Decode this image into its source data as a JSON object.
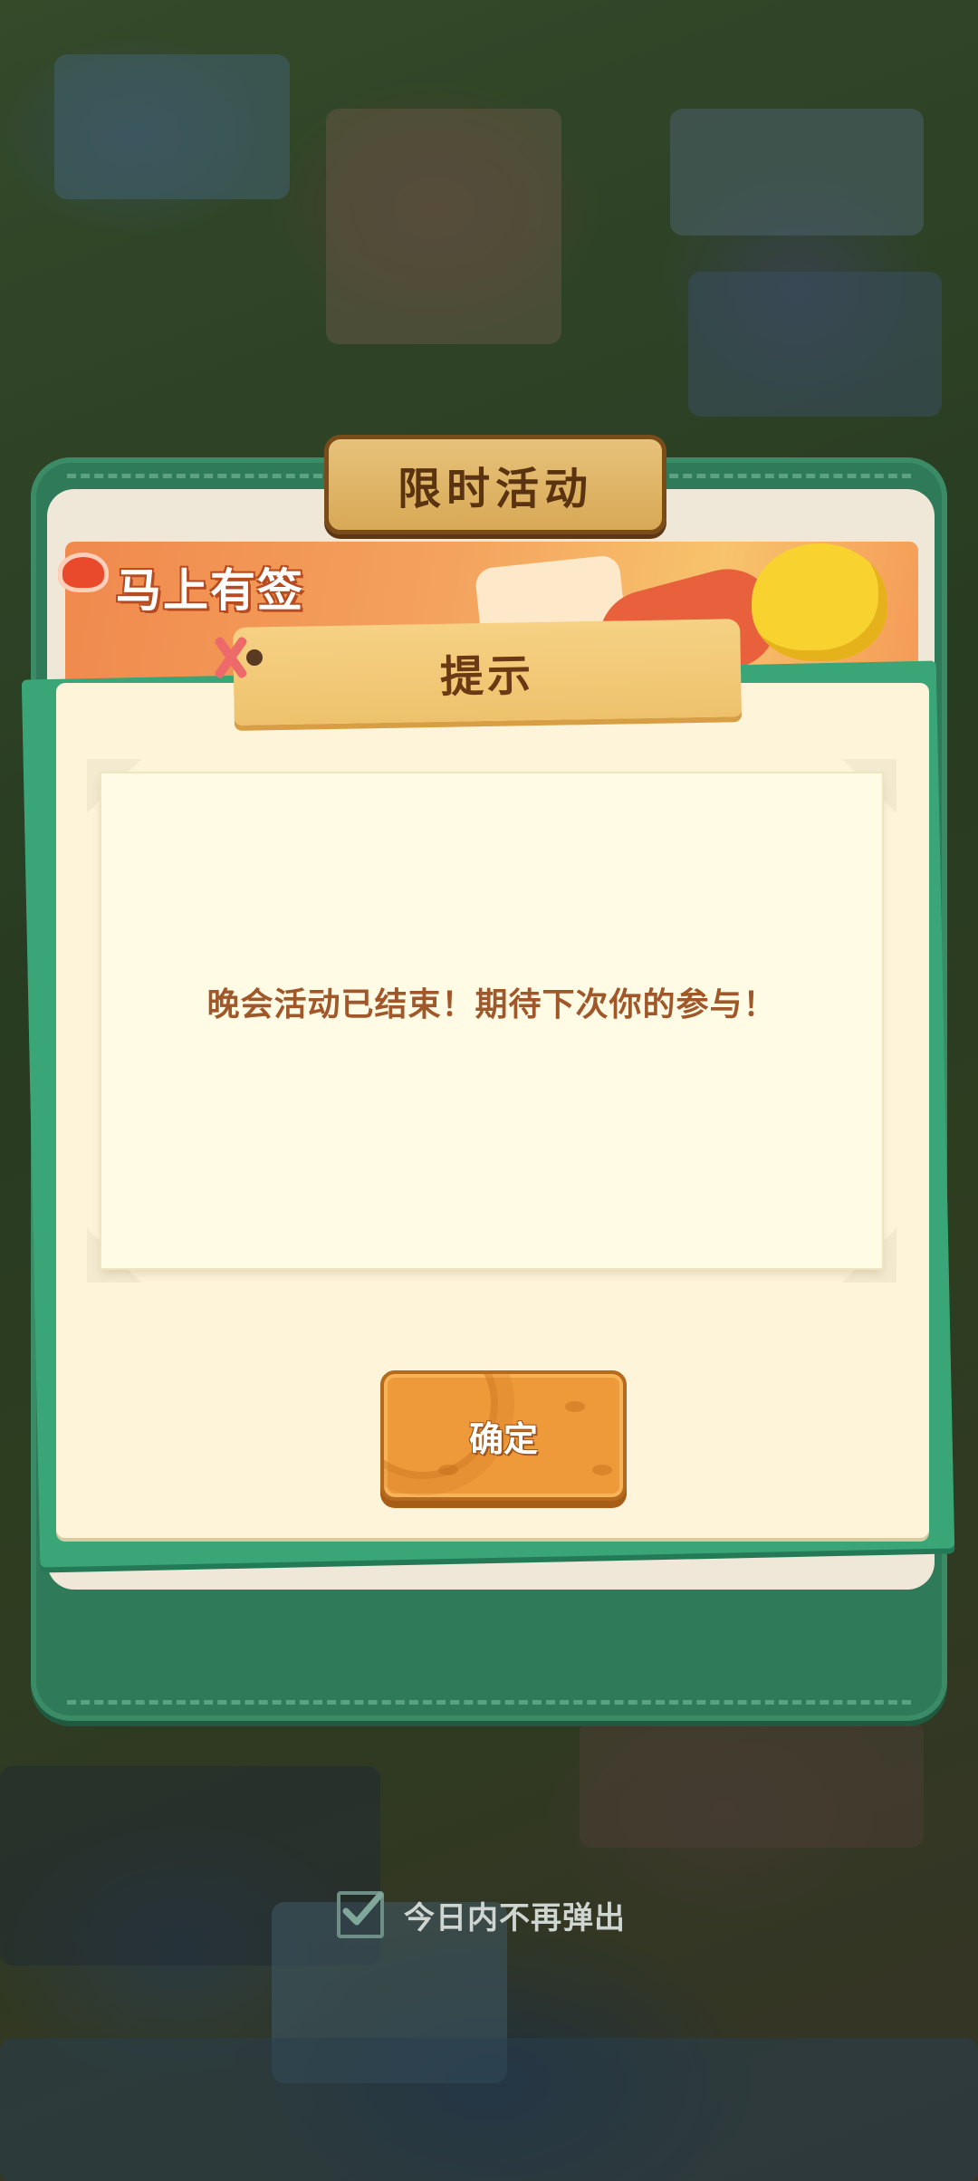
{
  "event_panel": {
    "header": "限时活动",
    "banner_title": "马上有签"
  },
  "dialog": {
    "title": "提示",
    "message": "晚会活动已结束！期待下次你的参与！",
    "confirm_label": "确定"
  },
  "footer": {
    "dont_show_today_label": "今日内不再弹出",
    "dont_show_today_checked": true
  },
  "colors": {
    "frame_green": "#2f7a58",
    "dialog_bg": "#fdf4da",
    "message_text": "#a0582b",
    "button_orange": "#ee9a3a"
  },
  "icons": {
    "checkbox_mark": "check-icon",
    "banner_logo": "chicken-icon"
  }
}
